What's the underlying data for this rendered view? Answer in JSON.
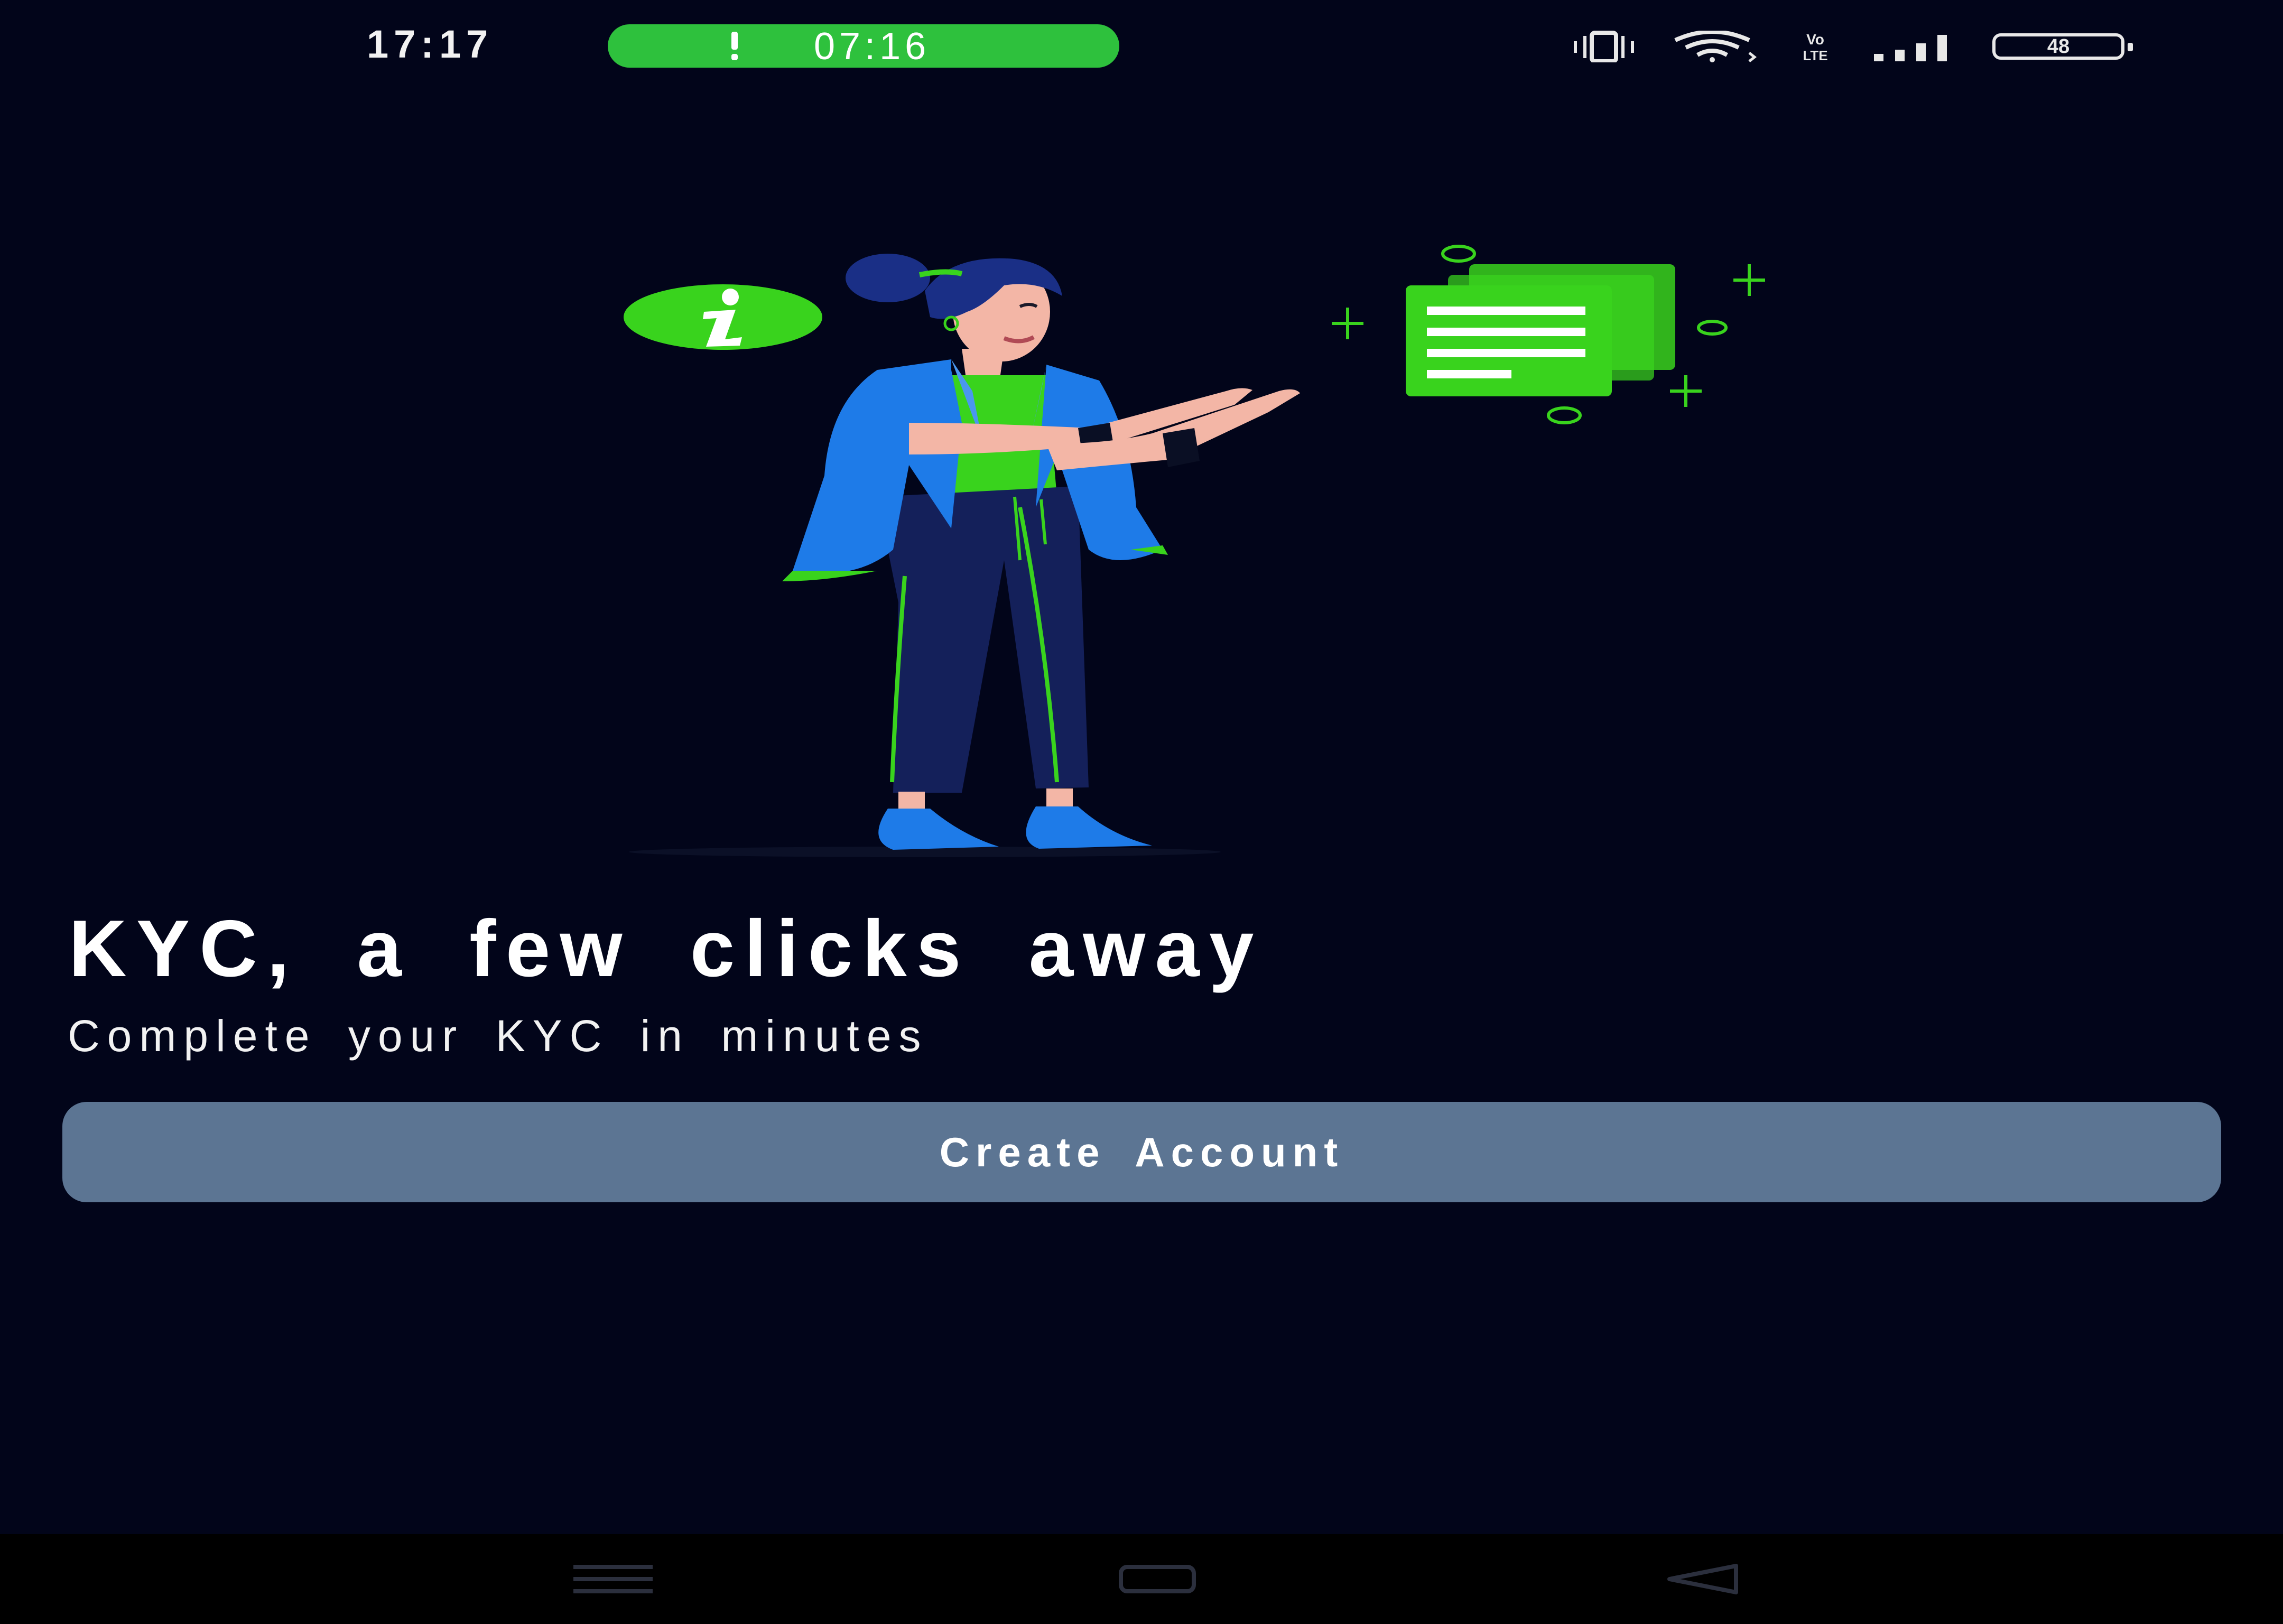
{
  "status_bar": {
    "time": "17:17",
    "call_timer": "07:16",
    "battery_level": "48",
    "icons": [
      "vibrate-icon",
      "wifi-icon",
      "volte-icon",
      "signal-icon",
      "battery-icon"
    ],
    "call_pill_color": "#2ec13d"
  },
  "onboarding": {
    "illustration": "woman-presenting-document-illustration",
    "title": "KYC, a few clicks away",
    "subtitle": "Complete your KYC in minutes",
    "primary_button_label": "Create Account"
  },
  "navigation_bar": {
    "buttons": [
      "menu-icon",
      "home-icon",
      "back-icon"
    ]
  },
  "colors": {
    "background": "#02051a",
    "accent_green": "#39d31d",
    "button_background": "#5c7593",
    "jacket_blue": "#1e7be8"
  }
}
